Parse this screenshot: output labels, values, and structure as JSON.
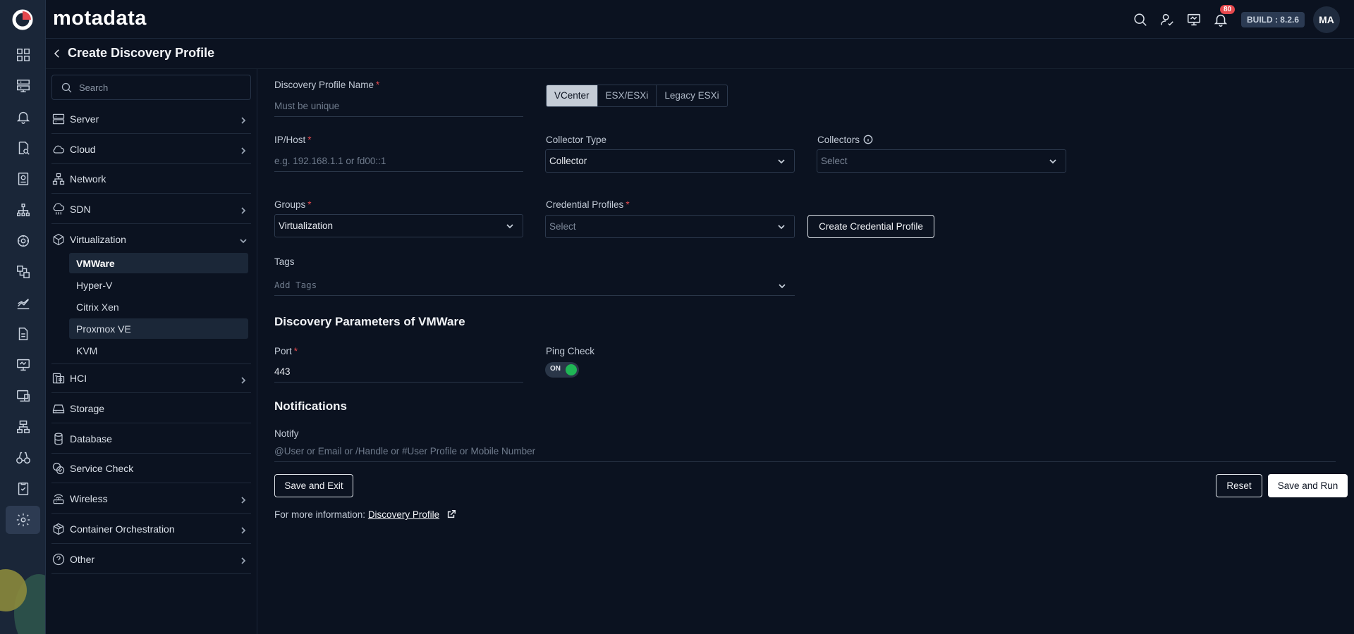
{
  "header": {
    "brand": "motadata",
    "notifications_count": "80",
    "build": "BUILD : 8.2.6",
    "avatar_initials": "MA",
    "icons": [
      "search-icon",
      "user-check-icon",
      "monitor-icon",
      "bell-icon"
    ]
  },
  "rail": {
    "icons": [
      "dashboard-icon",
      "inventory-icon",
      "alert-bell-icon",
      "log-search-icon",
      "report-icon",
      "topology-icon",
      "discovery-icon",
      "flow-icon",
      "metric-explorer-icon",
      "document-icon",
      "monitor-icon",
      "app-icon",
      "network-icon",
      "binoculars-icon",
      "audit-icon",
      "settings-icon"
    ],
    "active": "settings-icon"
  },
  "page": {
    "title": "Create Discovery Profile"
  },
  "sidebar": {
    "search_placeholder": "Search",
    "categories": [
      {
        "label": "Server",
        "icon": "server-icon",
        "expandable": true
      },
      {
        "label": "Cloud",
        "icon": "cloud-icon",
        "expandable": true
      },
      {
        "label": "Network",
        "icon": "network-icon",
        "expandable": false
      },
      {
        "label": "SDN",
        "icon": "sdn-icon",
        "expandable": true
      },
      {
        "label": "Virtualization",
        "icon": "cube-icon",
        "expandable": true,
        "expanded": true
      },
      {
        "label": "HCI",
        "icon": "hci-icon",
        "expandable": true
      },
      {
        "label": "Storage",
        "icon": "storage-icon",
        "expandable": false
      },
      {
        "label": "Database",
        "icon": "database-icon",
        "expandable": false
      },
      {
        "label": "Service Check",
        "icon": "service-check-icon",
        "expandable": false
      },
      {
        "label": "Wireless",
        "icon": "wireless-icon",
        "expandable": true
      },
      {
        "label": "Container Orchestration",
        "icon": "container-icon",
        "expandable": true
      },
      {
        "label": "Other",
        "icon": "help-circle-icon",
        "expandable": true
      }
    ],
    "virtualization_items": [
      "VMWare",
      "Hyper-V",
      "Citrix Xen",
      "Proxmox VE",
      "KVM"
    ],
    "selected_item": "VMWare"
  },
  "form": {
    "profile_name_label": "Discovery Profile Name",
    "profile_name_placeholder": "Must be unique",
    "type_tabs": [
      "VCenter",
      "ESX/ESXi",
      "Legacy ESXi"
    ],
    "active_tab": "VCenter",
    "ip_label": "IP/Host",
    "ip_placeholder": "e.g. 192.168.1.1 or fd00::1",
    "collector_type_label": "Collector Type",
    "collector_type_value": "Collector",
    "collectors_label": "Collectors",
    "collectors_value": "Select",
    "groups_label": "Groups",
    "groups_value": "Virtualization",
    "credential_label": "Credential Profiles",
    "credential_value": "Select",
    "create_credential_button": "Create Credential Profile",
    "tags_label": "Tags",
    "tags_placeholder": "Add Tags",
    "params_title": "Discovery Parameters of VMWare",
    "port_label": "Port",
    "port_value": "443",
    "ping_label": "Ping Check",
    "ping_state": "ON",
    "notifications_title": "Notifications",
    "notify_label": "Notify",
    "notify_placeholder": "@User or Email or /Handle or #User Profile or Mobile Number",
    "save_exit_button": "Save and Exit",
    "reset_button": "Reset",
    "save_run_button": "Save and Run",
    "more_info_prefix": "For more information:",
    "more_info_link": "Discovery Profile"
  },
  "colors": {
    "background": "#0b1220",
    "rail": "#1a2638",
    "required": "#e5484d",
    "toggle_on": "#1fb655",
    "badge": "#e5484d"
  }
}
